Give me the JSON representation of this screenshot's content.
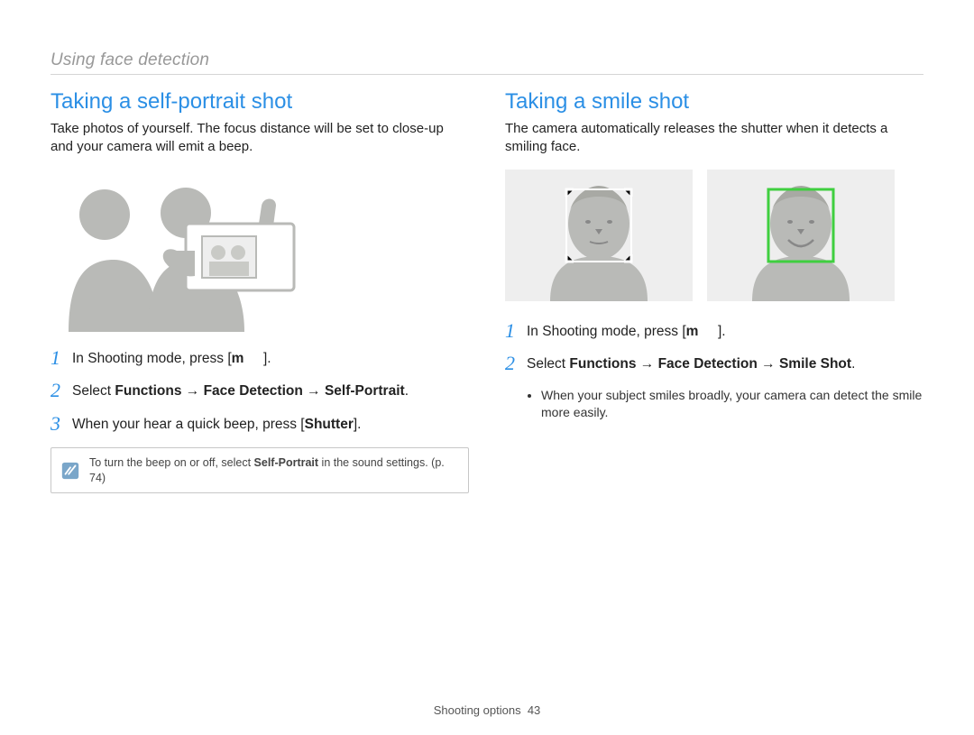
{
  "page": {
    "section_title": "Using face detection",
    "footer_label": "Shooting options",
    "page_number": "43"
  },
  "left": {
    "heading": "Taking a self-portrait shot",
    "description": "Take photos of yourself. The focus distance will be set to close-up and your camera will emit a beep.",
    "steps": [
      {
        "num": "1",
        "html": "In Shooting mode, press [<b>m</b>&nbsp;&nbsp;&nbsp;&nbsp;&nbsp;]."
      },
      {
        "num": "2",
        "html": "Select <b>Functions</b> → <b>Face Detection</b> → <b>Self-Portrait</b>."
      },
      {
        "num": "3",
        "html": "When your hear a quick beep, press [<b>Shutter</b>]."
      }
    ],
    "note_html": "To turn the beep on or off, select <b>Self-Portrait</b> in the sound settings. (p. 74)"
  },
  "right": {
    "heading": "Taking a smile shot",
    "description": "The camera automatically releases the shutter when it detects a smiling face.",
    "steps": [
      {
        "num": "1",
        "html": "In Shooting mode, press [<b>m</b>&nbsp;&nbsp;&nbsp;&nbsp;&nbsp;]."
      },
      {
        "num": "2",
        "html": "Select <b>Functions</b> → <b>Face Detection</b> → <b>Smile Shot</b>."
      }
    ],
    "sub_bullet": "When your subject smiles broadly, your camera can detect the smile more easily."
  }
}
